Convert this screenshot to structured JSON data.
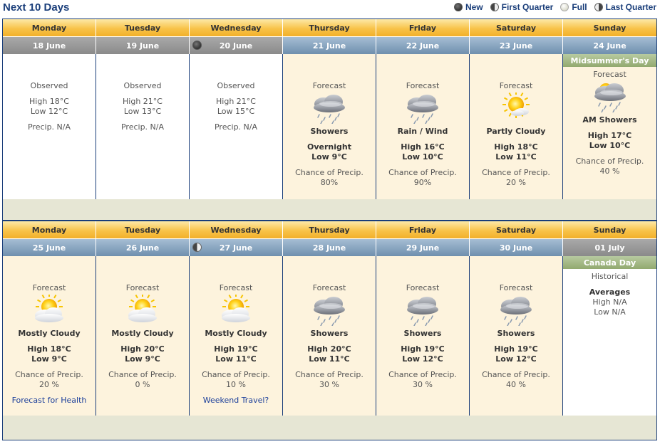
{
  "header": {
    "title": "Next 10 Days",
    "legend": [
      {
        "label": "New",
        "icon": "moon-new-icon"
      },
      {
        "label": "First Quarter",
        "icon": "moon-first-quarter-icon"
      },
      {
        "label": "Full",
        "icon": "moon-full-icon"
      },
      {
        "label": "Last Quarter",
        "icon": "moon-last-quarter-icon"
      }
    ]
  },
  "week1": {
    "days": [
      {
        "name": "Monday",
        "date": "18 June",
        "kind": "observed",
        "title": "Observed",
        "high": "High 18°C",
        "low": "Low 12°C",
        "precip": "Precip. N/A"
      },
      {
        "name": "Tuesday",
        "date": "19 June",
        "kind": "observed",
        "title": "Observed",
        "high": "High 21°C",
        "low": "Low 13°C",
        "precip": "Precip. N/A"
      },
      {
        "name": "Wednesday",
        "date": "20 June",
        "kind": "observed",
        "moon": "new",
        "title": "Observed",
        "high": "High 21°C",
        "low": "Low 15°C",
        "precip": "Precip. N/A"
      },
      {
        "name": "Thursday",
        "date": "21 June",
        "kind": "forecast",
        "title": "Forecast",
        "icon": "showers-icon",
        "condition": "Showers",
        "line1": "Overnight",
        "line2": "Low 9°C",
        "chance_label": "Chance of Precip.",
        "chance": "80%"
      },
      {
        "name": "Friday",
        "date": "22 June",
        "kind": "forecast",
        "title": "Forecast",
        "icon": "rain-wind-icon",
        "condition": "Rain / Wind",
        "line1": "High 16°C",
        "line2": "Low 10°C",
        "chance_label": "Chance of Precip.",
        "chance": "90%"
      },
      {
        "name": "Saturday",
        "date": "23 June",
        "kind": "forecast",
        "title": "Forecast",
        "icon": "partly-cloudy-icon",
        "condition": "Partly Cloudy",
        "line1": "High 18°C",
        "line2": "Low 11°C",
        "chance_label": "Chance of Precip.",
        "chance": "20 %"
      },
      {
        "name": "Sunday",
        "date": "24 June",
        "kind": "forecast",
        "special": "Midsummer's Day",
        "title": "Forecast",
        "icon": "am-showers-icon",
        "condition": "AM Showers",
        "line1": "High 17°C",
        "line2": "Low 10°C",
        "chance_label": "Chance of Precip.",
        "chance": "40 %"
      }
    ]
  },
  "week2": {
    "days": [
      {
        "name": "Monday",
        "date": "25 June",
        "kind": "forecast",
        "title": "Forecast",
        "icon": "mostly-cloudy-icon",
        "condition": "Mostly Cloudy",
        "line1": "High 18°C",
        "line2": "Low 9°C",
        "chance_label": "Chance of Precip.",
        "chance": "20 %",
        "link": "Forecast for Health"
      },
      {
        "name": "Tuesday",
        "date": "26 June",
        "kind": "forecast",
        "title": "Forecast",
        "icon": "mostly-cloudy-icon",
        "condition": "Mostly Cloudy",
        "line1": "High 20°C",
        "line2": "Low 9°C",
        "chance_label": "Chance of Precip.",
        "chance": "0 %"
      },
      {
        "name": "Wednesday",
        "date": "27 June",
        "kind": "forecast",
        "moon": "first-quarter",
        "title": "Forecast",
        "icon": "mostly-cloudy-icon",
        "condition": "Mostly Cloudy",
        "line1": "High 19°C",
        "line2": "Low 11°C",
        "chance_label": "Chance of Precip.",
        "chance": "10 %",
        "link": "Weekend Travel?"
      },
      {
        "name": "Thursday",
        "date": "28 June",
        "kind": "forecast",
        "title": "Forecast",
        "icon": "showers-icon",
        "condition": "Showers",
        "line1": "High 20°C",
        "line2": "Low 11°C",
        "chance_label": "Chance of Precip.",
        "chance": "30 %"
      },
      {
        "name": "Friday",
        "date": "29 June",
        "kind": "forecast",
        "title": "Forecast",
        "icon": "showers-icon",
        "condition": "Showers",
        "line1": "High 19°C",
        "line2": "Low 12°C",
        "chance_label": "Chance of Precip.",
        "chance": "30 %"
      },
      {
        "name": "Saturday",
        "date": "30 June",
        "kind": "forecast",
        "title": "Forecast",
        "icon": "showers-icon",
        "condition": "Showers",
        "line1": "High 19°C",
        "line2": "Low 12°C",
        "chance_label": "Chance of Precip.",
        "chance": "40 %"
      },
      {
        "name": "Sunday",
        "date": "01 July",
        "kind": "historical",
        "special": "Canada Day",
        "title": "Historical",
        "averages": "Averages",
        "line1": "High N/A",
        "line2": "Low N/A"
      }
    ]
  },
  "colors": {
    "brand_blue": "#1a3e7a",
    "dayname_gold": "#f8c349",
    "date_past": "#8a8a8a",
    "date_future": "#6f8fae",
    "forecast_bg": "#fdf3dd",
    "special_green": "#92a96f"
  }
}
